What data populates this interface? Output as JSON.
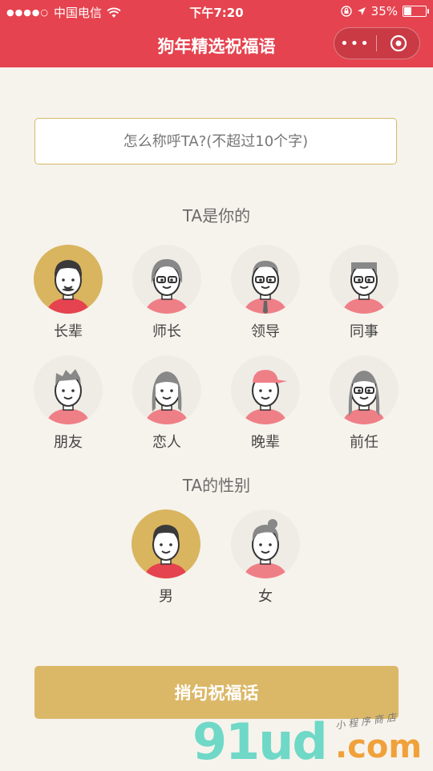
{
  "status_bar": {
    "carrier": "中国电信",
    "time": "下午7:20",
    "battery": "35%"
  },
  "navbar": {
    "title": "狗年精选祝福语",
    "more_icon": "more-dots-icon",
    "close_icon": "target-icon"
  },
  "name_input": {
    "placeholder": "怎么称呼TA?(不超过10个字)",
    "value": ""
  },
  "relation_section": {
    "title": "TA是你的",
    "items": [
      {
        "label": "长辈",
        "selected": true
      },
      {
        "label": "师长",
        "selected": false
      },
      {
        "label": "领导",
        "selected": false
      },
      {
        "label": "同事",
        "selected": false
      },
      {
        "label": "朋友",
        "selected": false
      },
      {
        "label": "恋人",
        "selected": false
      },
      {
        "label": "晚辈",
        "selected": false
      },
      {
        "label": "前任",
        "selected": false
      }
    ]
  },
  "gender_section": {
    "title": "TA的性别",
    "items": [
      {
        "label": "男",
        "selected": true
      },
      {
        "label": "女",
        "selected": false
      }
    ]
  },
  "submit_button": {
    "label": "捎句祝福话"
  },
  "watermark": {
    "main": "91ud",
    "domain": ".com",
    "caption": "小程序商店"
  },
  "colors": {
    "header_red": "#e5434f",
    "accent_gold": "#dbb868",
    "background": "#f6f3ec"
  }
}
